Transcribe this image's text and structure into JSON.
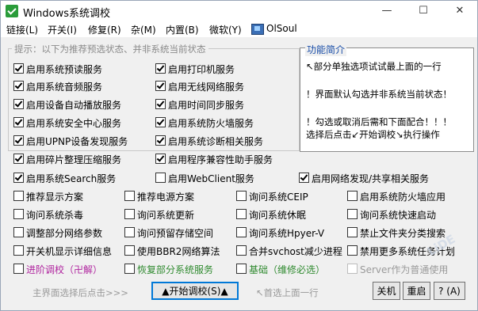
{
  "window": {
    "title": "Windows系统调校"
  },
  "titlebar": {
    "min": "—",
    "max": "☐",
    "close": "✕"
  },
  "menu": {
    "items": [
      "链接(L)",
      "开关(I)",
      "修复(R)",
      "杂(M)",
      "内置(B)",
      "微软(Y)",
      "OlSoul"
    ]
  },
  "group": {
    "label": "提示：以下为推荐预选状态、并非系统当前状态"
  },
  "info": {
    "title": "功能简介",
    "lines": [
      "↖部分单独选项试试最上面的一行",
      "！界面默认勾选并非系统当前状态！",
      "！勾选或取消后需和下面配合！！！",
      "选择后点击↙开始调校↘执行操作"
    ]
  },
  "checks": {
    "c1": "启用系统预读服务",
    "c2": "启用打印机服务",
    "c3": "启用系统音频服务",
    "c4": "启用无线网络服务",
    "c5": "启用设备自动播放服务",
    "c6": "启用时间同步服务",
    "c7": "启用系统安全中心服务",
    "c8": "启用系统防火墙服务",
    "c9": "启用UPNP设备发现服务",
    "c10": "启用系统诊断相关服务",
    "c11": "启用碎片整理压缩服务",
    "c12": "启用程序兼容性助手服务",
    "c13": "启用系统Search服务",
    "c14": "启用WebClient服务",
    "c15": "启用网络发现/共享相关服务",
    "r1a": "推荐显示方案",
    "r1b": "推荐电源方案",
    "r1c": "询问系统CEIP",
    "r1d": "启用系统防火墙应用",
    "r2a": "询问系统杀毒",
    "r2b": "询问系统更新",
    "r2c": "询问系统休眠",
    "r2d": "询问系统快速启动",
    "r3a": "调整部分网络参数",
    "r3b": "询问预留存储空间",
    "r3c": "询问系统Hpyer-V",
    "r3d": "禁止文件夹分类搜索",
    "r4a": "开关机显示详细信息",
    "r4b": "使用BBR2网络算法",
    "r4c": "合并svchost减少进程",
    "r4d": "禁用更多系统任务计划",
    "r5a": "进阶调校（卍解）",
    "r5b": "恢复部分系统服务",
    "r5c": "基础（维修必选）",
    "r5d": "Server作为普通使用"
  },
  "colors": {
    "r5a": "#b0259f",
    "r5b": "#2f8a2f",
    "r5c": "#2f8a2f",
    "disabled": "#9a9a9a"
  },
  "bottom": {
    "hint_left": "主界面选择后点击>>>",
    "start": "▲开始调校(S)▲",
    "hint_mid": "↖首选上面一行",
    "shutdown": "关机",
    "restart": "重启",
    "help": "? (A)"
  }
}
